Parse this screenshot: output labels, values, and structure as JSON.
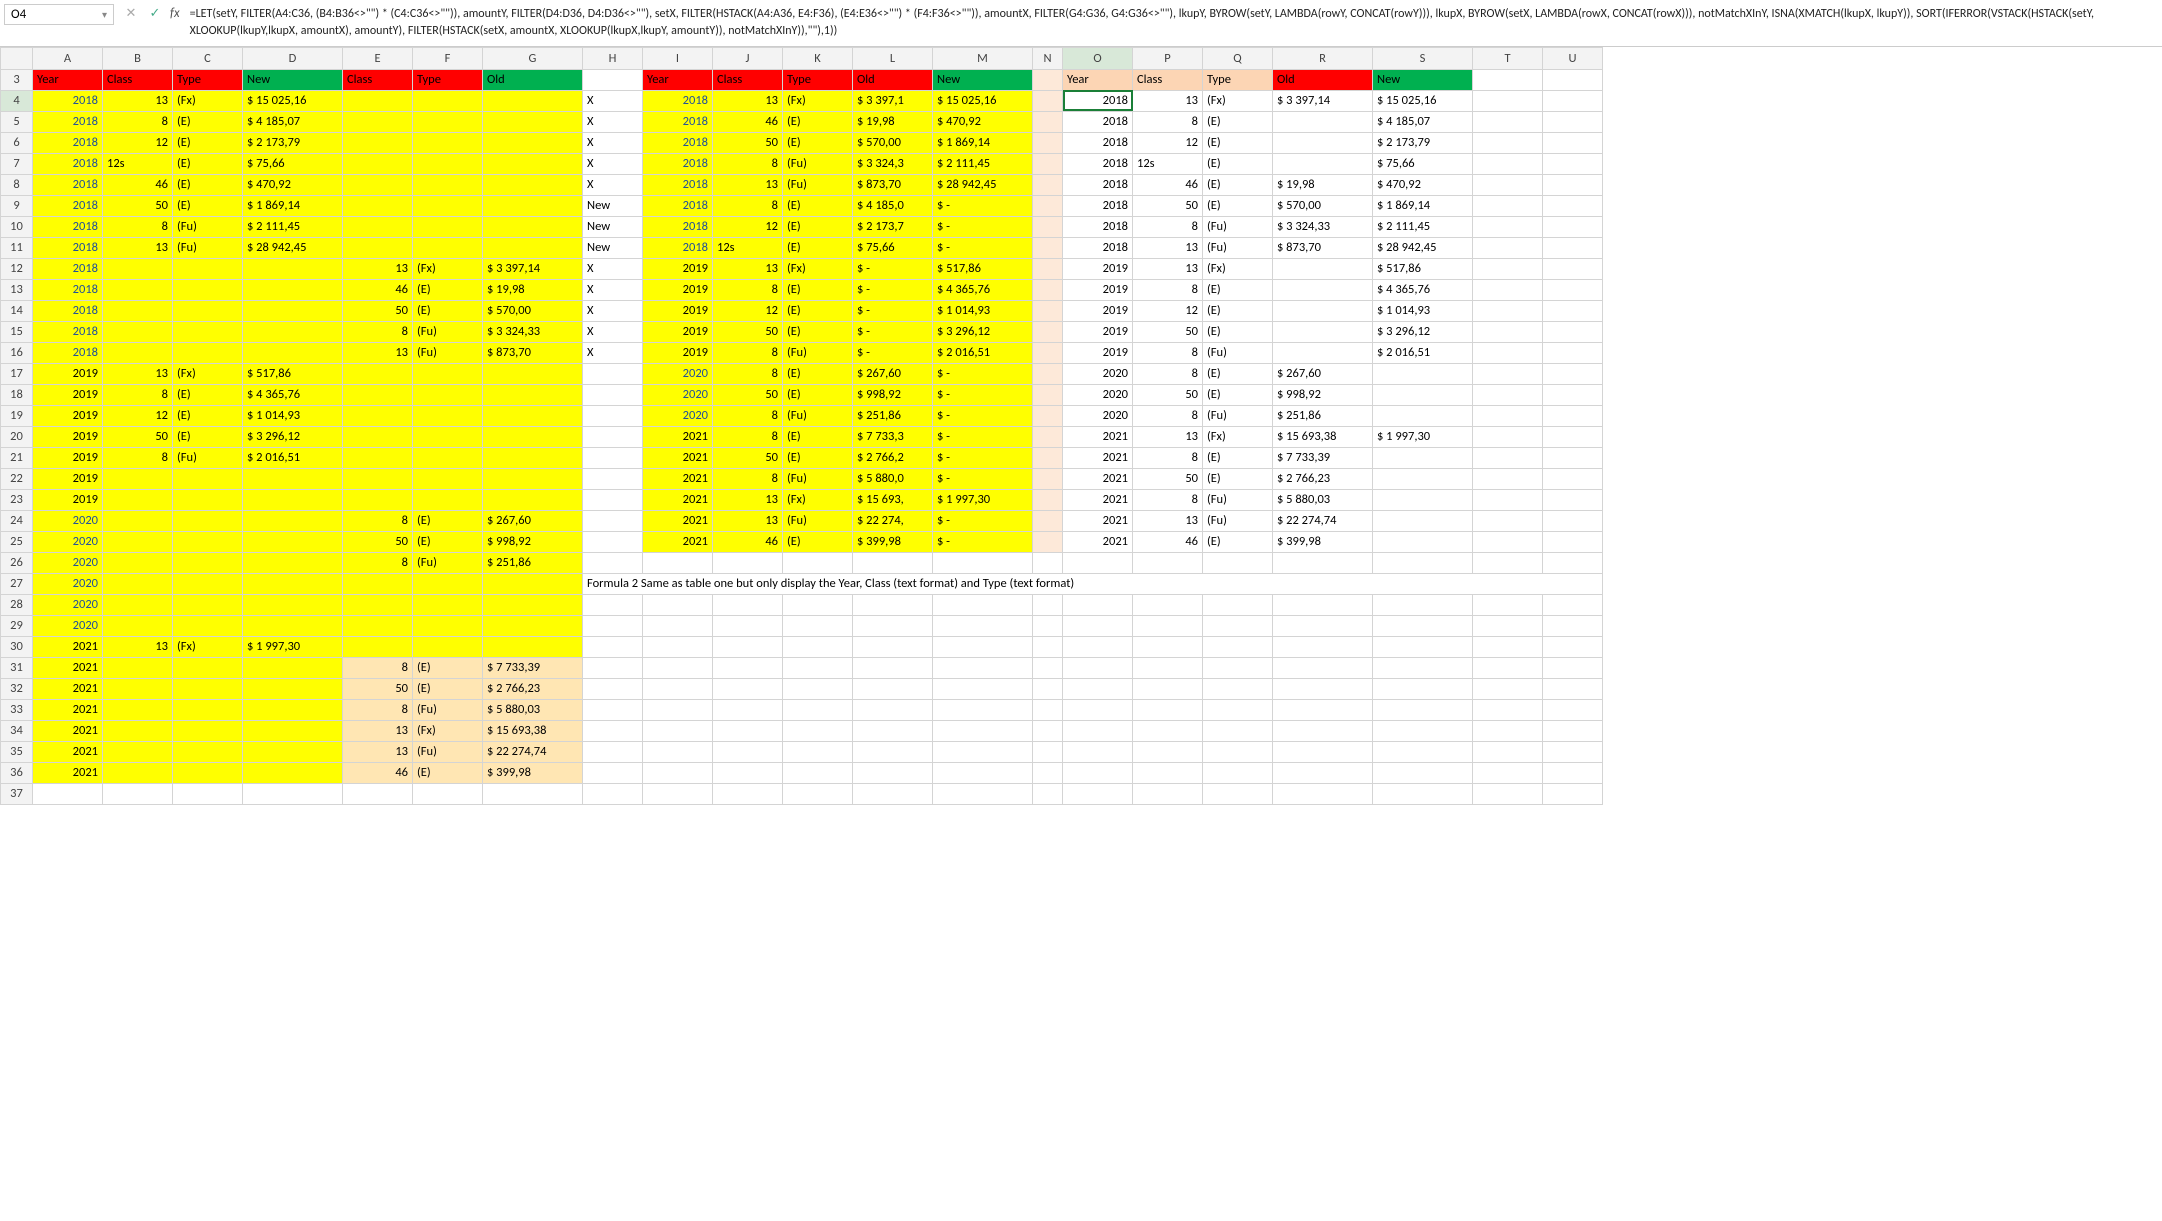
{
  "cell_ref": "O4",
  "formula": "=LET(setY, FILTER(A4:C36, (B4:B36<>\"\") * (C4:C36<>\"\")), amountY, FILTER(D4:D36, D4:D36<>\"\"), setX, FILTER(HSTACK(A4:A36, E4:F36), (E4:E36<>\"\") * (F4:F36<>\"\")), amountX, FILTER(G4:G36, G4:G36<>\"\"), lkupY, BYROW(setY, LAMBDA(rowY, CONCAT(rowY))), lkupX, BYROW(setX, LAMBDA(rowX, CONCAT(rowX))), notMatchXInY, ISNA(XMATCH(lkupX, lkupY)), SORT(IFERROR(VSTACK(HSTACK(setY, XLOOKUP(lkupY,lkupX, amountX), amountY), FILTER(HSTACK(setX, amountX, XLOOKUP(lkupX,lkupY, amountY)), notMatchXInY)),\"\"),1))",
  "columns": [
    "A",
    "B",
    "C",
    "D",
    "E",
    "F",
    "G",
    "H",
    "I",
    "J",
    "K",
    "L",
    "M",
    "N",
    "O",
    "P",
    "Q",
    "R",
    "S",
    "T",
    "U"
  ],
  "row_start": 3,
  "headers_left": {
    "A": "Year",
    "B": "Class",
    "C": "Type",
    "D": "New",
    "E": "Class",
    "F": "Type",
    "G": "Old"
  },
  "headers_mid": {
    "I": "Year",
    "J": "Class",
    "K": "Type",
    "L": "Old",
    "M": "New"
  },
  "headers_right": {
    "O": "Year",
    "P": "Class",
    "Q": "Type",
    "R": "Old",
    "S": "New"
  },
  "note_row": 27,
  "note_text": "Formula 2 Same as table one but only display the Year, Class (text format) and Type (text format)",
  "rows": [
    {
      "r": 4,
      "A": "2018",
      "B": "13",
      "C": "(Fx)",
      "D": "$ 15 025,16",
      "H": "X",
      "I": "2018",
      "J": "13",
      "K": "(Fx)",
      "L": "$ 3 397,1",
      "M": "$ 15 025,16",
      "O": "2018",
      "P": "13",
      "Q": "(Fx)",
      "R": "$ 3 397,14",
      "S": "$ 15 025,16",
      "ablue": true,
      "iblue": true
    },
    {
      "r": 5,
      "A": "2018",
      "B": "8",
      "C": "(E)",
      "D": "$ 4 185,07",
      "H": "X",
      "I": "2018",
      "J": "46",
      "K": "(E)",
      "L": "$ 19,98",
      "M": "$ 470,92",
      "O": "2018",
      "P": "8",
      "Q": "(E)",
      "S": "$ 4 185,07",
      "ablue": true,
      "iblue": true
    },
    {
      "r": 6,
      "A": "2018",
      "B": "12",
      "C": "(E)",
      "D": "$ 2 173,79",
      "H": "X",
      "I": "2018",
      "J": "50",
      "K": "(E)",
      "L": "$ 570,00",
      "M": "$ 1 869,14",
      "O": "2018",
      "P": "12",
      "Q": "(E)",
      "S": "$ 2 173,79",
      "ablue": true,
      "iblue": true
    },
    {
      "r": 7,
      "A": "2018",
      "B": "12s",
      "C": "(E)",
      "D": "$ 75,66",
      "H": "X",
      "I": "2018",
      "J": "8",
      "K": "(Fu)",
      "L": "$ 3 324,3",
      "M": "$ 2 111,45",
      "O": "2018",
      "P": "12s",
      "Q": "(E)",
      "S": "$ 75,66",
      "ablue": true,
      "iblue": true,
      "bLeft": true,
      "pLeft": true
    },
    {
      "r": 8,
      "A": "2018",
      "B": "46",
      "C": "(E)",
      "D": "$ 470,92",
      "H": "X",
      "I": "2018",
      "J": "13",
      "K": "(Fu)",
      "L": "$ 873,70",
      "M": "$ 28 942,45",
      "O": "2018",
      "P": "46",
      "Q": "(E)",
      "R": "$ 19,98",
      "S": "$ 470,92",
      "ablue": true,
      "iblue": true
    },
    {
      "r": 9,
      "A": "2018",
      "B": "50",
      "C": "(E)",
      "D": "$ 1 869,14",
      "H": "New",
      "I": "2018",
      "J": "8",
      "K": "(E)",
      "L": "$ 4 185,0",
      "M": "$ -",
      "O": "2018",
      "P": "50",
      "Q": "(E)",
      "R": "$ 570,00",
      "S": "$ 1 869,14",
      "ablue": true,
      "iblue": true
    },
    {
      "r": 10,
      "A": "2018",
      "B": "8",
      "C": "(Fu)",
      "D": "$ 2 111,45",
      "H": "New",
      "I": "2018",
      "J": "12",
      "K": "(E)",
      "L": "$ 2 173,7",
      "M": "$ -",
      "O": "2018",
      "P": "8",
      "Q": "(Fu)",
      "R": "$ 3 324,33",
      "S": "$ 2 111,45",
      "ablue": true,
      "iblue": true
    },
    {
      "r": 11,
      "A": "2018",
      "B": "13",
      "C": "(Fu)",
      "D": "$ 28 942,45",
      "H": "New",
      "I": "2018",
      "J": "12s",
      "K": "(E)",
      "L": "$ 75,66",
      "M": "$ -",
      "O": "2018",
      "P": "13",
      "Q": "(Fu)",
      "R": "$ 873,70",
      "S": "$ 28 942,45",
      "ablue": true,
      "iblue": true,
      "jLeft": true
    },
    {
      "r": 12,
      "A": "2018",
      "E": "13",
      "F": "(Fx)",
      "G": "$ 3 397,14",
      "H": "X",
      "I": "2019",
      "J": "13",
      "K": "(Fx)",
      "L": "$ -",
      "M": "$ 517,86",
      "O": "2019",
      "P": "13",
      "Q": "(Fx)",
      "S": "$ 517,86",
      "ablue": true
    },
    {
      "r": 13,
      "A": "2018",
      "E": "46",
      "F": "(E)",
      "G": "$ 19,98",
      "H": "X",
      "I": "2019",
      "J": "8",
      "K": "(E)",
      "L": "$ -",
      "M": "$ 4 365,76",
      "O": "2019",
      "P": "8",
      "Q": "(E)",
      "S": "$ 4 365,76",
      "ablue": true
    },
    {
      "r": 14,
      "A": "2018",
      "E": "50",
      "F": "(E)",
      "G": "$ 570,00",
      "H": "X",
      "I": "2019",
      "J": "12",
      "K": "(E)",
      "L": "$ -",
      "M": "$ 1 014,93",
      "O": "2019",
      "P": "12",
      "Q": "(E)",
      "S": "$ 1 014,93",
      "ablue": true
    },
    {
      "r": 15,
      "A": "2018",
      "E": "8",
      "F": "(Fu)",
      "G": "$ 3 324,33",
      "H": "X",
      "I": "2019",
      "J": "50",
      "K": "(E)",
      "L": "$ -",
      "M": "$ 3 296,12",
      "O": "2019",
      "P": "50",
      "Q": "(E)",
      "S": "$ 3 296,12",
      "ablue": true
    },
    {
      "r": 16,
      "A": "2018",
      "E": "13",
      "F": "(Fu)",
      "G": "$ 873,70",
      "H": "X",
      "I": "2019",
      "J": "8",
      "K": "(Fu)",
      "L": "$ -",
      "M": "$ 2 016,51",
      "O": "2019",
      "P": "8",
      "Q": "(Fu)",
      "S": "$ 2 016,51",
      "ablue": true
    },
    {
      "r": 17,
      "A": "2019",
      "B": "13",
      "C": "(Fx)",
      "D": "$ 517,86",
      "I": "2020",
      "J": "8",
      "K": "(E)",
      "L": "$ 267,60",
      "M": "$ -",
      "O": "2020",
      "P": "8",
      "Q": "(E)",
      "R": "$ 267,60",
      "iblue": true
    },
    {
      "r": 18,
      "A": "2019",
      "B": "8",
      "C": "(E)",
      "D": "$ 4 365,76",
      "I": "2020",
      "J": "50",
      "K": "(E)",
      "L": "$ 998,92",
      "M": "$ -",
      "O": "2020",
      "P": "50",
      "Q": "(E)",
      "R": "$ 998,92",
      "iblue": true
    },
    {
      "r": 19,
      "A": "2019",
      "B": "12",
      "C": "(E)",
      "D": "$ 1 014,93",
      "I": "2020",
      "J": "8",
      "K": "(Fu)",
      "L": "$ 251,86",
      "M": "$ -",
      "O": "2020",
      "P": "8",
      "Q": "(Fu)",
      "R": "$ 251,86",
      "iblue": true
    },
    {
      "r": 20,
      "A": "2019",
      "B": "50",
      "C": "(E)",
      "D": "$ 3 296,12",
      "I": "2021",
      "J": "8",
      "K": "(E)",
      "L": "$ 7 733,3",
      "M": "$ -",
      "O": "2021",
      "P": "13",
      "Q": "(Fx)",
      "R": "$ 15 693,38",
      "S": "$ 1 997,30"
    },
    {
      "r": 21,
      "A": "2019",
      "B": "8",
      "C": "(Fu)",
      "D": "$ 2 016,51",
      "I": "2021",
      "J": "50",
      "K": "(E)",
      "L": "$ 2 766,2",
      "M": "$ -",
      "O": "2021",
      "P": "8",
      "Q": "(E)",
      "R": "$ 7 733,39"
    },
    {
      "r": 22,
      "A": "2019",
      "I": "2021",
      "J": "8",
      "K": "(Fu)",
      "L": "$ 5 880,0",
      "M": "$ -",
      "O": "2021",
      "P": "50",
      "Q": "(E)",
      "R": "$ 2 766,23"
    },
    {
      "r": 23,
      "A": "2019",
      "I": "2021",
      "J": "13",
      "K": "(Fx)",
      "L": "$ 15 693,",
      "M": "$ 1 997,30",
      "O": "2021",
      "P": "8",
      "Q": "(Fu)",
      "R": "$ 5 880,03"
    },
    {
      "r": 24,
      "A": "2020",
      "E": "8",
      "F": "(E)",
      "G": "$ 267,60",
      "I": "2021",
      "J": "13",
      "K": "(Fu)",
      "L": "$ 22 274,",
      "M": "$ -",
      "O": "2021",
      "P": "13",
      "Q": "(Fu)",
      "R": "$ 22 274,74",
      "ablue": true
    },
    {
      "r": 25,
      "A": "2020",
      "E": "50",
      "F": "(E)",
      "G": "$ 998,92",
      "I": "2021",
      "J": "46",
      "K": "(E)",
      "L": "$ 399,98",
      "M": "$ -",
      "O": "2021",
      "P": "46",
      "Q": "(E)",
      "R": "$ 399,98",
      "ablue": true
    },
    {
      "r": 26,
      "A": "2020",
      "E": "8",
      "F": "(Fu)",
      "G": "$ 251,86",
      "ablue": true
    },
    {
      "r": 27,
      "A": "2020",
      "ablue": true
    },
    {
      "r": 28,
      "A": "2020",
      "ablue": true
    },
    {
      "r": 29,
      "A": "2020",
      "ablue": true
    },
    {
      "r": 30,
      "A": "2021",
      "B": "13",
      "C": "(Fx)",
      "D": "$ 1 997,30"
    },
    {
      "r": 31,
      "A": "2021",
      "E": "8",
      "F": "(E)",
      "G": "$ 7 733,39",
      "efgCream": true
    },
    {
      "r": 32,
      "A": "2021",
      "E": "50",
      "F": "(E)",
      "G": "$ 2 766,23",
      "efgCream": true
    },
    {
      "r": 33,
      "A": "2021",
      "E": "8",
      "F": "(Fu)",
      "G": "$ 5 880,03",
      "efgCream": true
    },
    {
      "r": 34,
      "A": "2021",
      "E": "13",
      "F": "(Fx)",
      "G": "$ 15 693,38",
      "efgCream": true
    },
    {
      "r": 35,
      "A": "2021",
      "E": "13",
      "F": "(Fu)",
      "G": "$ 22 274,74",
      "efgCream": true
    },
    {
      "r": 36,
      "A": "2021",
      "E": "46",
      "F": "(E)",
      "G": "$ 399,98",
      "efgCream": true
    }
  ],
  "chart_data": {
    "type": "table",
    "title": "Merged Year/Class/Type with Old & New amounts",
    "columns": [
      "Year",
      "Class",
      "Type",
      "Old",
      "New"
    ],
    "rows": [
      [
        "2018",
        "13",
        "(Fx)",
        "$ 3 397,14",
        "$ 15 025,16"
      ],
      [
        "2018",
        "8",
        "(E)",
        "",
        "$ 4 185,07"
      ],
      [
        "2018",
        "12",
        "(E)",
        "",
        "$ 2 173,79"
      ],
      [
        "2018",
        "12s",
        "(E)",
        "",
        "$ 75,66"
      ],
      [
        "2018",
        "46",
        "(E)",
        "$ 19,98",
        "$ 470,92"
      ],
      [
        "2018",
        "50",
        "(E)",
        "$ 570,00",
        "$ 1 869,14"
      ],
      [
        "2018",
        "8",
        "(Fu)",
        "$ 3 324,33",
        "$ 2 111,45"
      ],
      [
        "2018",
        "13",
        "(Fu)",
        "$ 873,70",
        "$ 28 942,45"
      ],
      [
        "2019",
        "13",
        "(Fx)",
        "",
        "$ 517,86"
      ],
      [
        "2019",
        "8",
        "(E)",
        "",
        "$ 4 365,76"
      ],
      [
        "2019",
        "12",
        "(E)",
        "",
        "$ 1 014,93"
      ],
      [
        "2019",
        "50",
        "(E)",
        "",
        "$ 3 296,12"
      ],
      [
        "2019",
        "8",
        "(Fu)",
        "",
        "$ 2 016,51"
      ],
      [
        "2020",
        "8",
        "(E)",
        "$ 267,60",
        ""
      ],
      [
        "2020",
        "50",
        "(E)",
        "$ 998,92",
        ""
      ],
      [
        "2020",
        "8",
        "(Fu)",
        "$ 251,86",
        ""
      ],
      [
        "2021",
        "13",
        "(Fx)",
        "$ 15 693,38",
        "$ 1 997,30"
      ],
      [
        "2021",
        "8",
        "(E)",
        "$ 7 733,39",
        ""
      ],
      [
        "2021",
        "50",
        "(E)",
        "$ 2 766,23",
        ""
      ],
      [
        "2021",
        "8",
        "(Fu)",
        "$ 5 880,03",
        ""
      ],
      [
        "2021",
        "13",
        "(Fu)",
        "$ 22 274,74",
        ""
      ],
      [
        "2021",
        "46",
        "(E)",
        "$ 399,98",
        ""
      ]
    ]
  }
}
